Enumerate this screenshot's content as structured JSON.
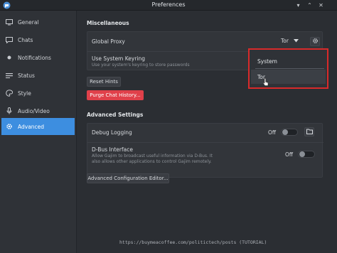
{
  "window": {
    "title": "Preferences",
    "minimize": "▾",
    "restore": "⌃",
    "close": "✕"
  },
  "sidebar": {
    "items": [
      {
        "label": "General",
        "icon": "monitor-icon",
        "active": false
      },
      {
        "label": "Chats",
        "icon": "chat-bubble-icon",
        "active": false
      },
      {
        "label": "Notifications",
        "icon": "dot-icon",
        "active": false
      },
      {
        "label": "Status",
        "icon": "status-bars-icon",
        "active": false
      },
      {
        "label": "Style",
        "icon": "palette-icon",
        "active": false
      },
      {
        "label": "Audio/Video",
        "icon": "microphone-icon",
        "active": false
      },
      {
        "label": "Advanced",
        "icon": "gear-icon",
        "active": true
      }
    ]
  },
  "misc": {
    "title": "Miscellaneous",
    "global_proxy": {
      "label": "Global Proxy",
      "value": "Tor"
    },
    "keyring": {
      "label": "Use System Keyring",
      "sub": "Use your system's keyring to store passwords"
    },
    "reset_hints": "Reset Hints",
    "purge_history": "Purge Chat History..."
  },
  "advanced": {
    "title": "Advanced Settings",
    "debug": {
      "label": "Debug Logging",
      "state": "Off"
    },
    "dbus": {
      "label": "D-Bus Interface",
      "sub1": "Allow Gajim to broadcast useful information via D-Bus. It",
      "sub2": "also allows other applications to control Gajim remotely.",
      "state": "Off"
    },
    "config_editor": "Advanced Configuration Editor..."
  },
  "proxy_dropdown": {
    "options": [
      "System",
      "Tor"
    ],
    "hovered": "Tor"
  },
  "watermark": "https://buymeacoffee.com/politictech/posts (TUTORIAL)",
  "colors": {
    "accent": "#3d8ee0",
    "danger": "#e0404a",
    "highlight_border": "#d82a2a"
  }
}
